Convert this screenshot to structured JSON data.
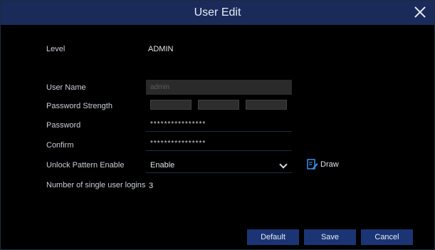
{
  "window": {
    "title": "User Edit"
  },
  "form": {
    "level_label": "Level",
    "level_value": "ADMIN",
    "username_label": "User Name",
    "username_value": "admin",
    "strength_label": "Password Strength",
    "password_label": "Password",
    "password_value": "****************",
    "confirm_label": "Confirm",
    "confirm_value": "****************",
    "unlock_label": "Unlock Pattern Enable",
    "unlock_value": "Enable",
    "draw_label": "Draw",
    "logins_label": "Number of single user logins",
    "logins_value": "3"
  },
  "buttons": {
    "default": "Default",
    "save": "Save",
    "cancel": "Cancel"
  },
  "icons": {
    "close": "close-icon",
    "chevron": "chevron-down-icon",
    "draw": "pencil-edit-icon"
  },
  "colors": {
    "titlebar": "#1a2b5a",
    "button": "#1b3574",
    "background": "#000000"
  }
}
